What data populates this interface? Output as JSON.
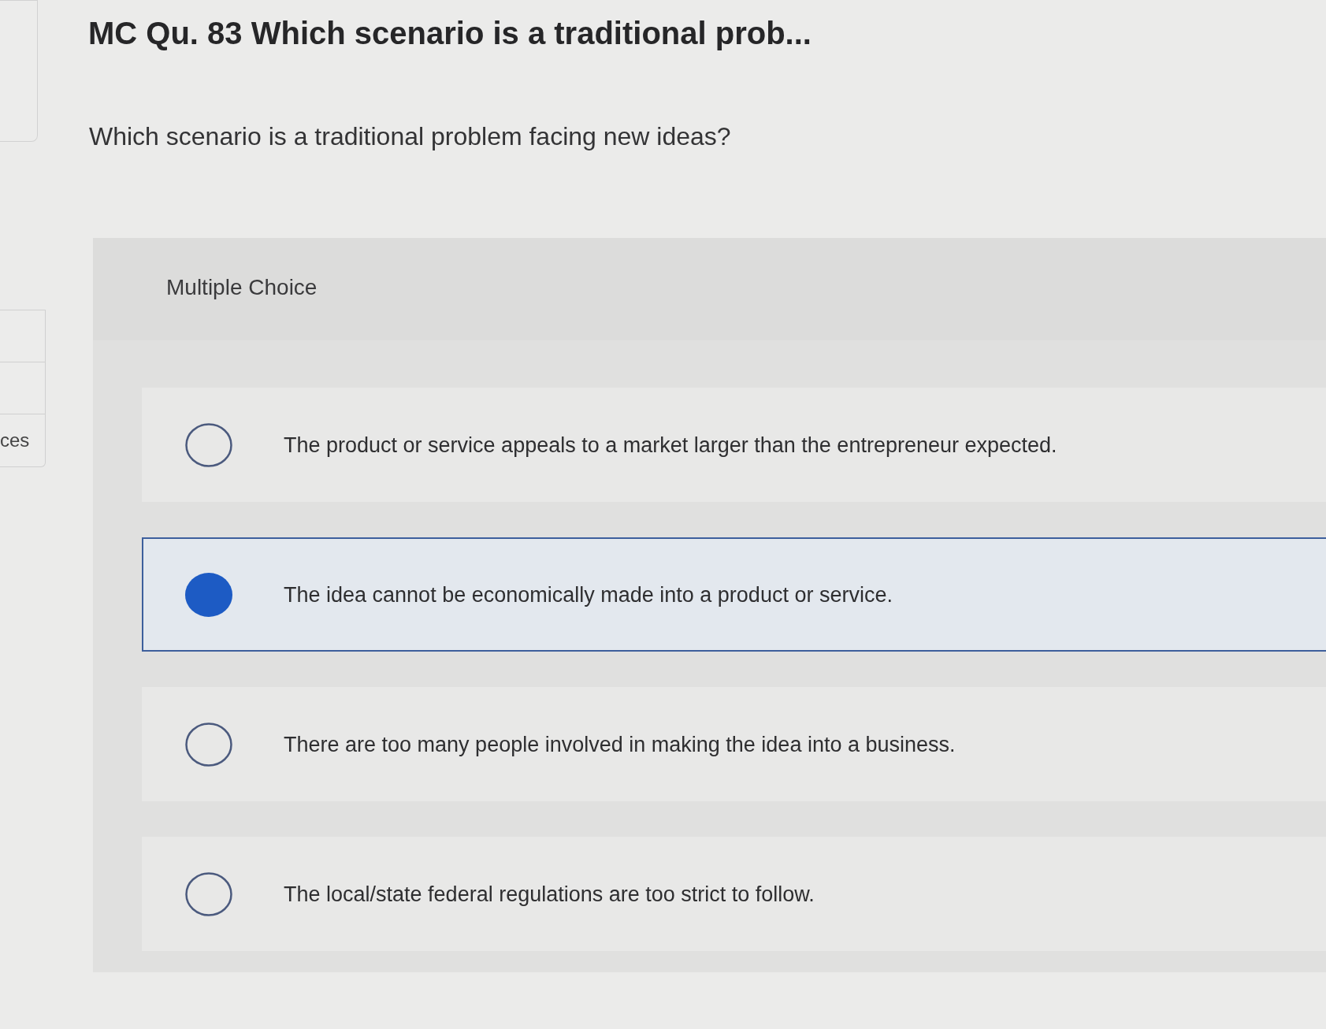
{
  "sidebar": {
    "label": "ces"
  },
  "question": {
    "title": "MC Qu. 83 Which scenario is a traditional prob...",
    "prompt": "Which scenario is a traditional problem facing new ideas?"
  },
  "answer_panel": {
    "heading": "Multiple Choice",
    "options": [
      {
        "text": "The product or service appeals to a market larger than the entrepreneur expected.",
        "selected": false
      },
      {
        "text": "The idea cannot be economically made into a product or service.",
        "selected": true
      },
      {
        "text": "There are too many people involved in making the idea into a business.",
        "selected": false
      },
      {
        "text": "The local/state federal regulations are too strict to follow.",
        "selected": false
      }
    ]
  }
}
